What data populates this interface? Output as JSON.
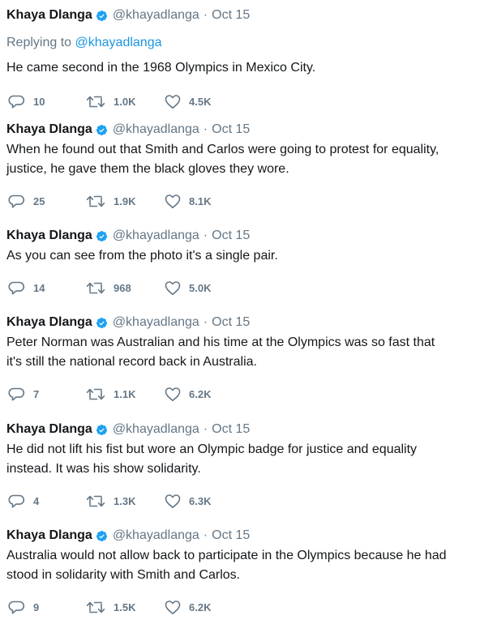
{
  "thread": {
    "tweets": [
      {
        "author": "Khaya Dlanga",
        "handle": "@khayadlanga",
        "separator": "·",
        "date": "Oct 15",
        "replying_prefix": "Replying to",
        "replying_to": "@khayadlanga",
        "text_lines": [
          "He came second in the 1968 Olympics in Mexico City."
        ],
        "replies": "10",
        "retweets": "1.0K",
        "likes": "4.5K"
      },
      {
        "author": "Khaya Dlanga",
        "handle": "@khayadlanga",
        "separator": "·",
        "date": "Oct 15",
        "text_lines": [
          "When he found out that Smith and Carlos were going to protest for equality,",
          "justice, he gave them the black gloves they wore."
        ],
        "replies": "25",
        "retweets": "1.9K",
        "likes": "8.1K"
      },
      {
        "author": "Khaya Dlanga",
        "handle": "@khayadlanga",
        "separator": "·",
        "date": "Oct 15",
        "text_lines": [
          "As you can see from the photo it's a single pair."
        ],
        "replies": "14",
        "retweets": "968",
        "likes": "5.0K"
      },
      {
        "author": "Khaya Dlanga",
        "handle": "@khayadlanga",
        "separator": "·",
        "date": "Oct 15",
        "text_lines": [
          "Peter Norman was Australian and his time at the Olympics was so fast that",
          "it's still the national record back in Australia."
        ],
        "replies": "7",
        "retweets": "1.1K",
        "likes": "6.2K"
      },
      {
        "author": "Khaya Dlanga",
        "handle": "@khayadlanga",
        "separator": "·",
        "date": "Oct 15",
        "text_lines": [
          "He did not lift his fist but wore an Olympic badge for justice and equality",
          "instead. It was his show solidarity."
        ],
        "replies": "4",
        "retweets": "1.3K",
        "likes": "6.3K"
      },
      {
        "author": "Khaya Dlanga",
        "handle": "@khayadlanga",
        "separator": "·",
        "date": "Oct 15",
        "text_lines": [
          "Australia would not allow back to participate in the Olympics because he had",
          "stood in solidarity with Smith and Carlos."
        ],
        "replies": "9",
        "retweets": "1.5K",
        "likes": "6.2K"
      }
    ]
  },
  "icons": {
    "verified": "verified-badge-icon",
    "reply": "reply-bubble-icon",
    "retweet": "retweet-arrows-icon",
    "like": "heart-outline-icon"
  },
  "colors": {
    "text": "#14171a",
    "muted": "#657786",
    "link": "#1b95e0",
    "verified": "#1da1f2"
  }
}
